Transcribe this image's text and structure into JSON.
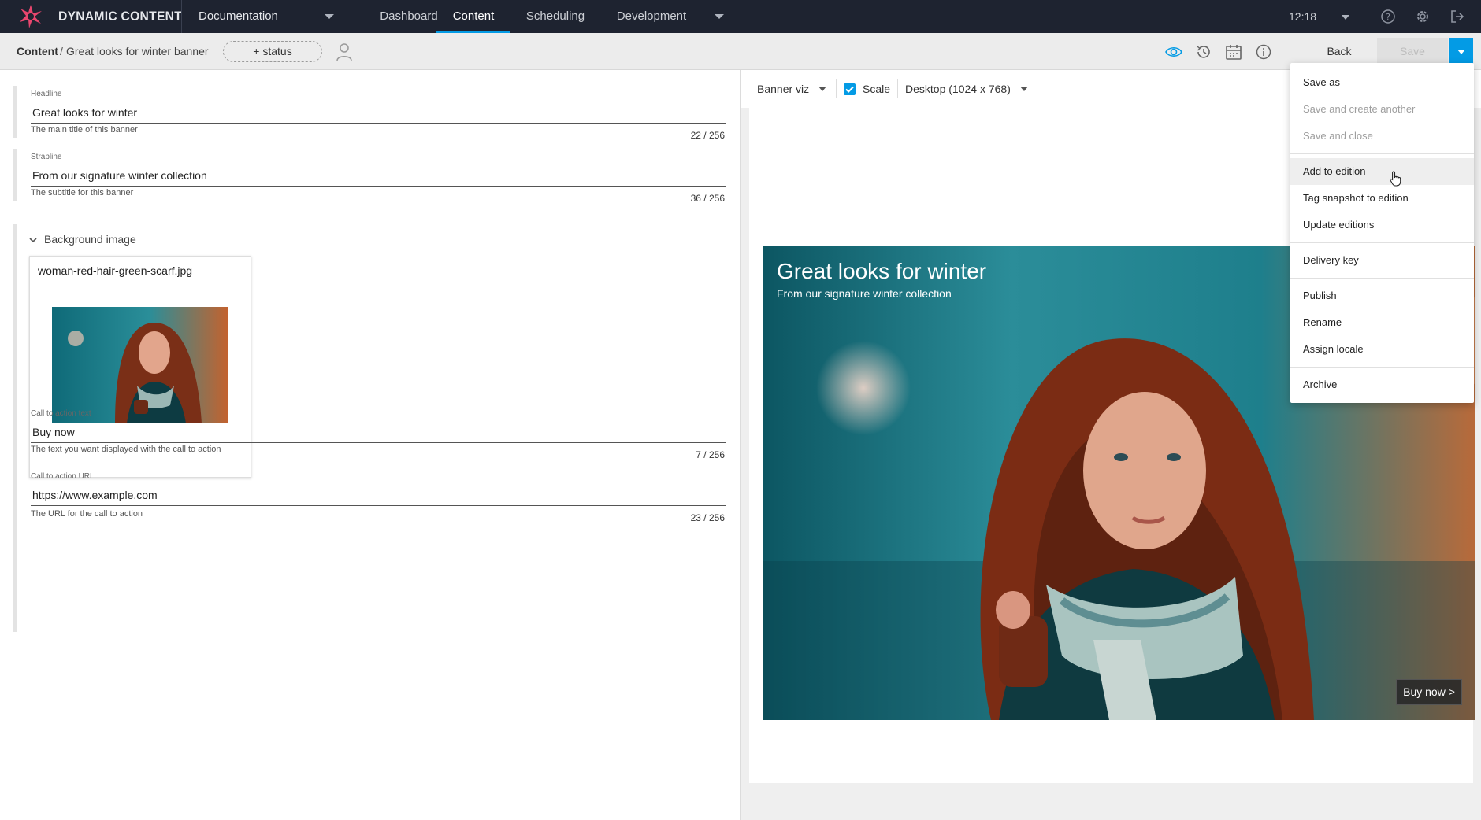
{
  "topnav": {
    "brand": "DYNAMIC CONTENT",
    "hub": "Documentation",
    "tabs": [
      {
        "label": "Dashboard"
      },
      {
        "label": "Content",
        "active": true
      },
      {
        "label": "Scheduling"
      },
      {
        "label": "Development"
      }
    ],
    "time": "12:18",
    "icons": [
      "help-icon",
      "settings-icon",
      "logout-icon"
    ]
  },
  "toolbar": {
    "breadcrumb_root": "Content",
    "breadcrumb_sep": "/",
    "breadcrumb_current": "Great looks for winter banner",
    "status_label": "+ status",
    "icons": [
      "visualization-icon",
      "history-icon",
      "calendar-icon",
      "info-icon"
    ],
    "back_label": "Back",
    "save_label": "Save"
  },
  "form": {
    "headline": {
      "label": "Headline",
      "value": "Great looks for winter",
      "help": "The main title of this banner",
      "count": "22 / 256"
    },
    "strapline": {
      "label": "Strapline",
      "value": "From our signature winter collection",
      "help": "The subtitle for this banner",
      "count": "36 / 256"
    },
    "background": {
      "title": "Background image",
      "filename": "woman-red-hair-green-scarf.jpg"
    },
    "cta_text": {
      "label": "Call to action text",
      "value": "Buy now",
      "help": "The text you want displayed with the call to action",
      "count": "7 / 256"
    },
    "cta_url": {
      "label": "Call to action URL",
      "value": "https://www.example.com",
      "help": "The URL for the call to action",
      "count": "23 / 256"
    }
  },
  "preview": {
    "visualization": "Banner viz",
    "scale_label": "Scale",
    "scale_checked": true,
    "device": "Desktop (1024 x 768)",
    "banner": {
      "headline": "Great looks for winter",
      "strapline": "From our signature winter collection",
      "cta": "Buy now >"
    }
  },
  "menu": {
    "items": [
      {
        "label": "Save as",
        "disabled": false
      },
      {
        "label": "Save and create another",
        "disabled": true
      },
      {
        "label": "Save and close",
        "disabled": true
      },
      {
        "label": "Add to edition",
        "disabled": false,
        "hovered": true
      },
      {
        "label": "Tag snapshot to edition",
        "disabled": false
      },
      {
        "label": "Update editions",
        "disabled": false
      },
      {
        "label": "Delivery key",
        "disabled": false
      },
      {
        "label": "Publish",
        "disabled": false
      },
      {
        "label": "Rename",
        "disabled": false
      },
      {
        "label": "Assign locale",
        "disabled": false
      },
      {
        "label": "Archive",
        "disabled": false
      }
    ]
  },
  "colors": {
    "nav_bg": "#1e2330",
    "accent": "#039be5",
    "logo": "#e8466e"
  }
}
